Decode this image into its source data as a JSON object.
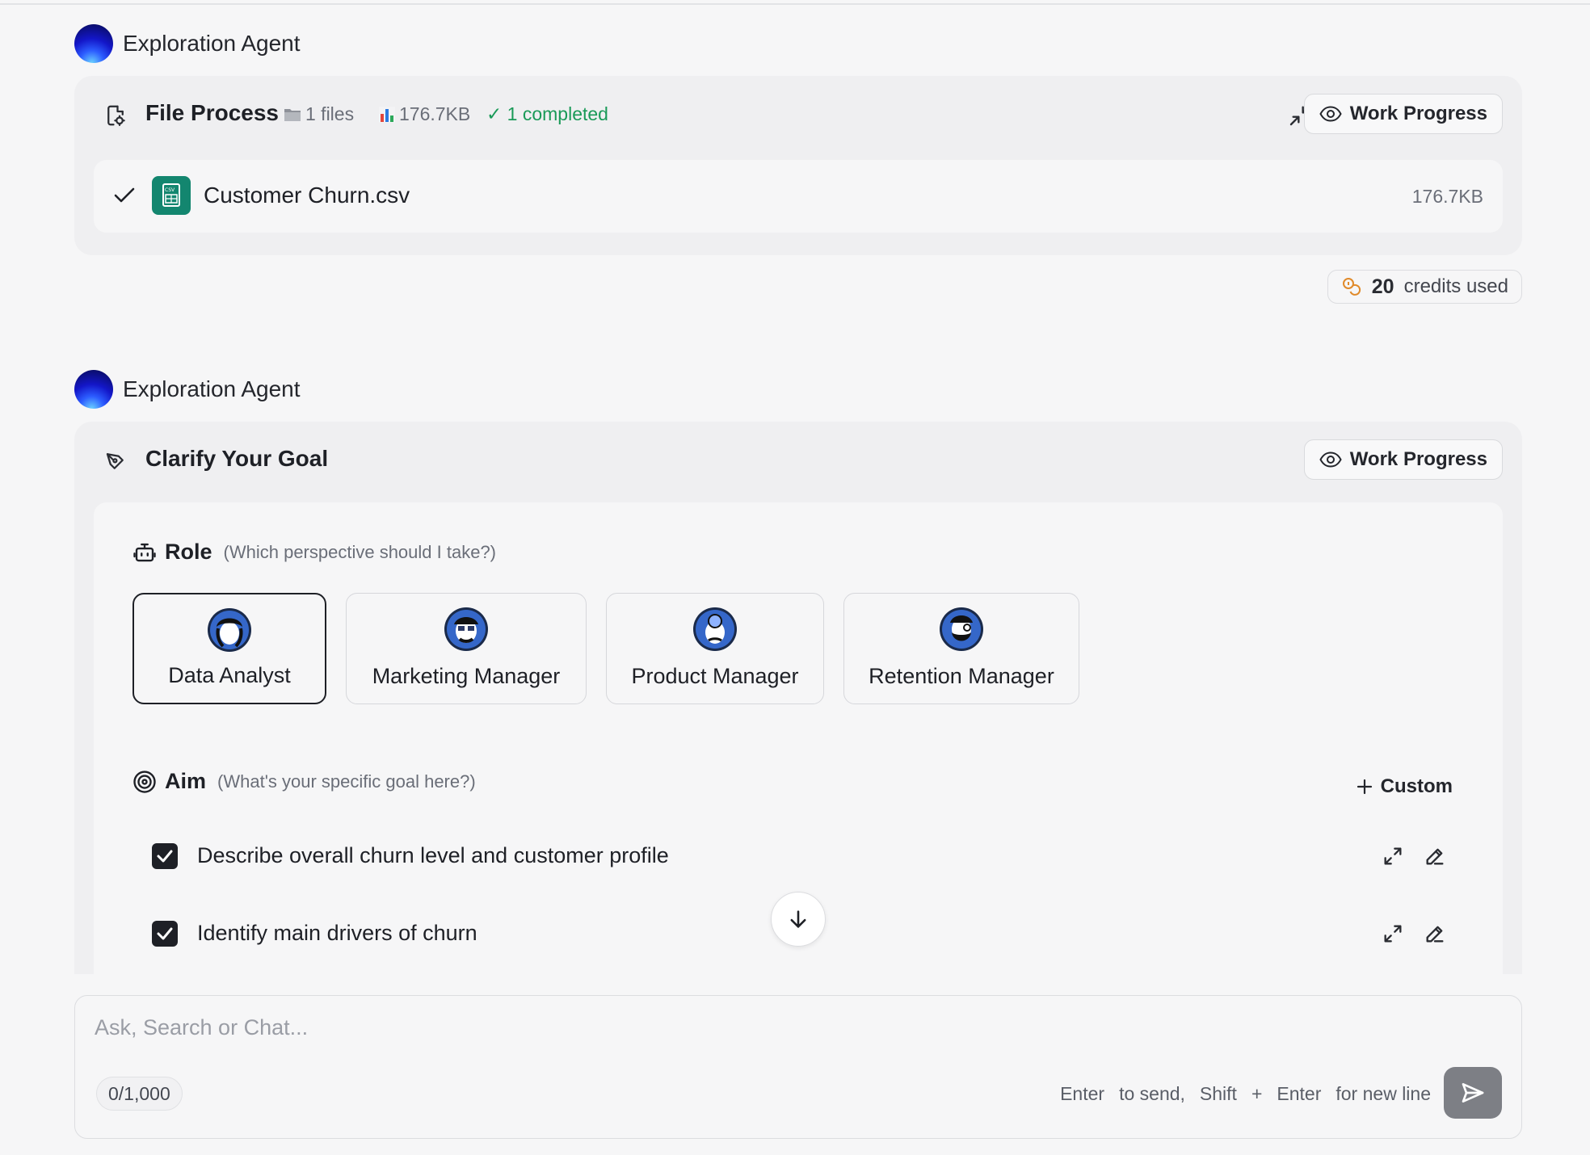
{
  "first_block": {
    "agent_name": "Exploration Agent",
    "title": "File Process",
    "files_count": "1 files",
    "total_size": "176.7KB",
    "completed": "✓ 1 completed",
    "work_progress_label": "Work Progress",
    "file": {
      "name": "Customer Churn.csv",
      "size": "176.7KB"
    }
  },
  "credits": {
    "amount": "20",
    "label": "credits used"
  },
  "second_block": {
    "agent_name": "Exploration Agent",
    "title": "Clarify Your Goal",
    "work_progress_label": "Work Progress",
    "role": {
      "label": "Role",
      "hint": "(Which perspective should I take?)",
      "options": [
        {
          "name": "Data Analyst",
          "selected": true
        },
        {
          "name": "Marketing Manager",
          "selected": false
        },
        {
          "name": "Product Manager",
          "selected": false
        },
        {
          "name": "Retention Manager",
          "selected": false
        }
      ]
    },
    "aim": {
      "label": "Aim",
      "hint": "(What's your specific goal here?)",
      "custom_label": "Custom",
      "items": [
        {
          "text": "Describe overall churn level and customer profile",
          "checked": true
        },
        {
          "text": "Identify main drivers of churn",
          "checked": true
        }
      ]
    }
  },
  "chat_input": {
    "placeholder": "Ask, Search or Chat...",
    "counter": "0/1,000",
    "hint": {
      "enter1": "Enter",
      "to_send": "to send,",
      "shift": "Shift",
      "plus": "+",
      "enter2": "Enter",
      "new_line": "for new line"
    }
  },
  "colors": {
    "accent_green": "#1a9a58",
    "csv_icon": "#13866f",
    "credit_icon": "#e08a2a",
    "send_button": "#7d7f85"
  }
}
